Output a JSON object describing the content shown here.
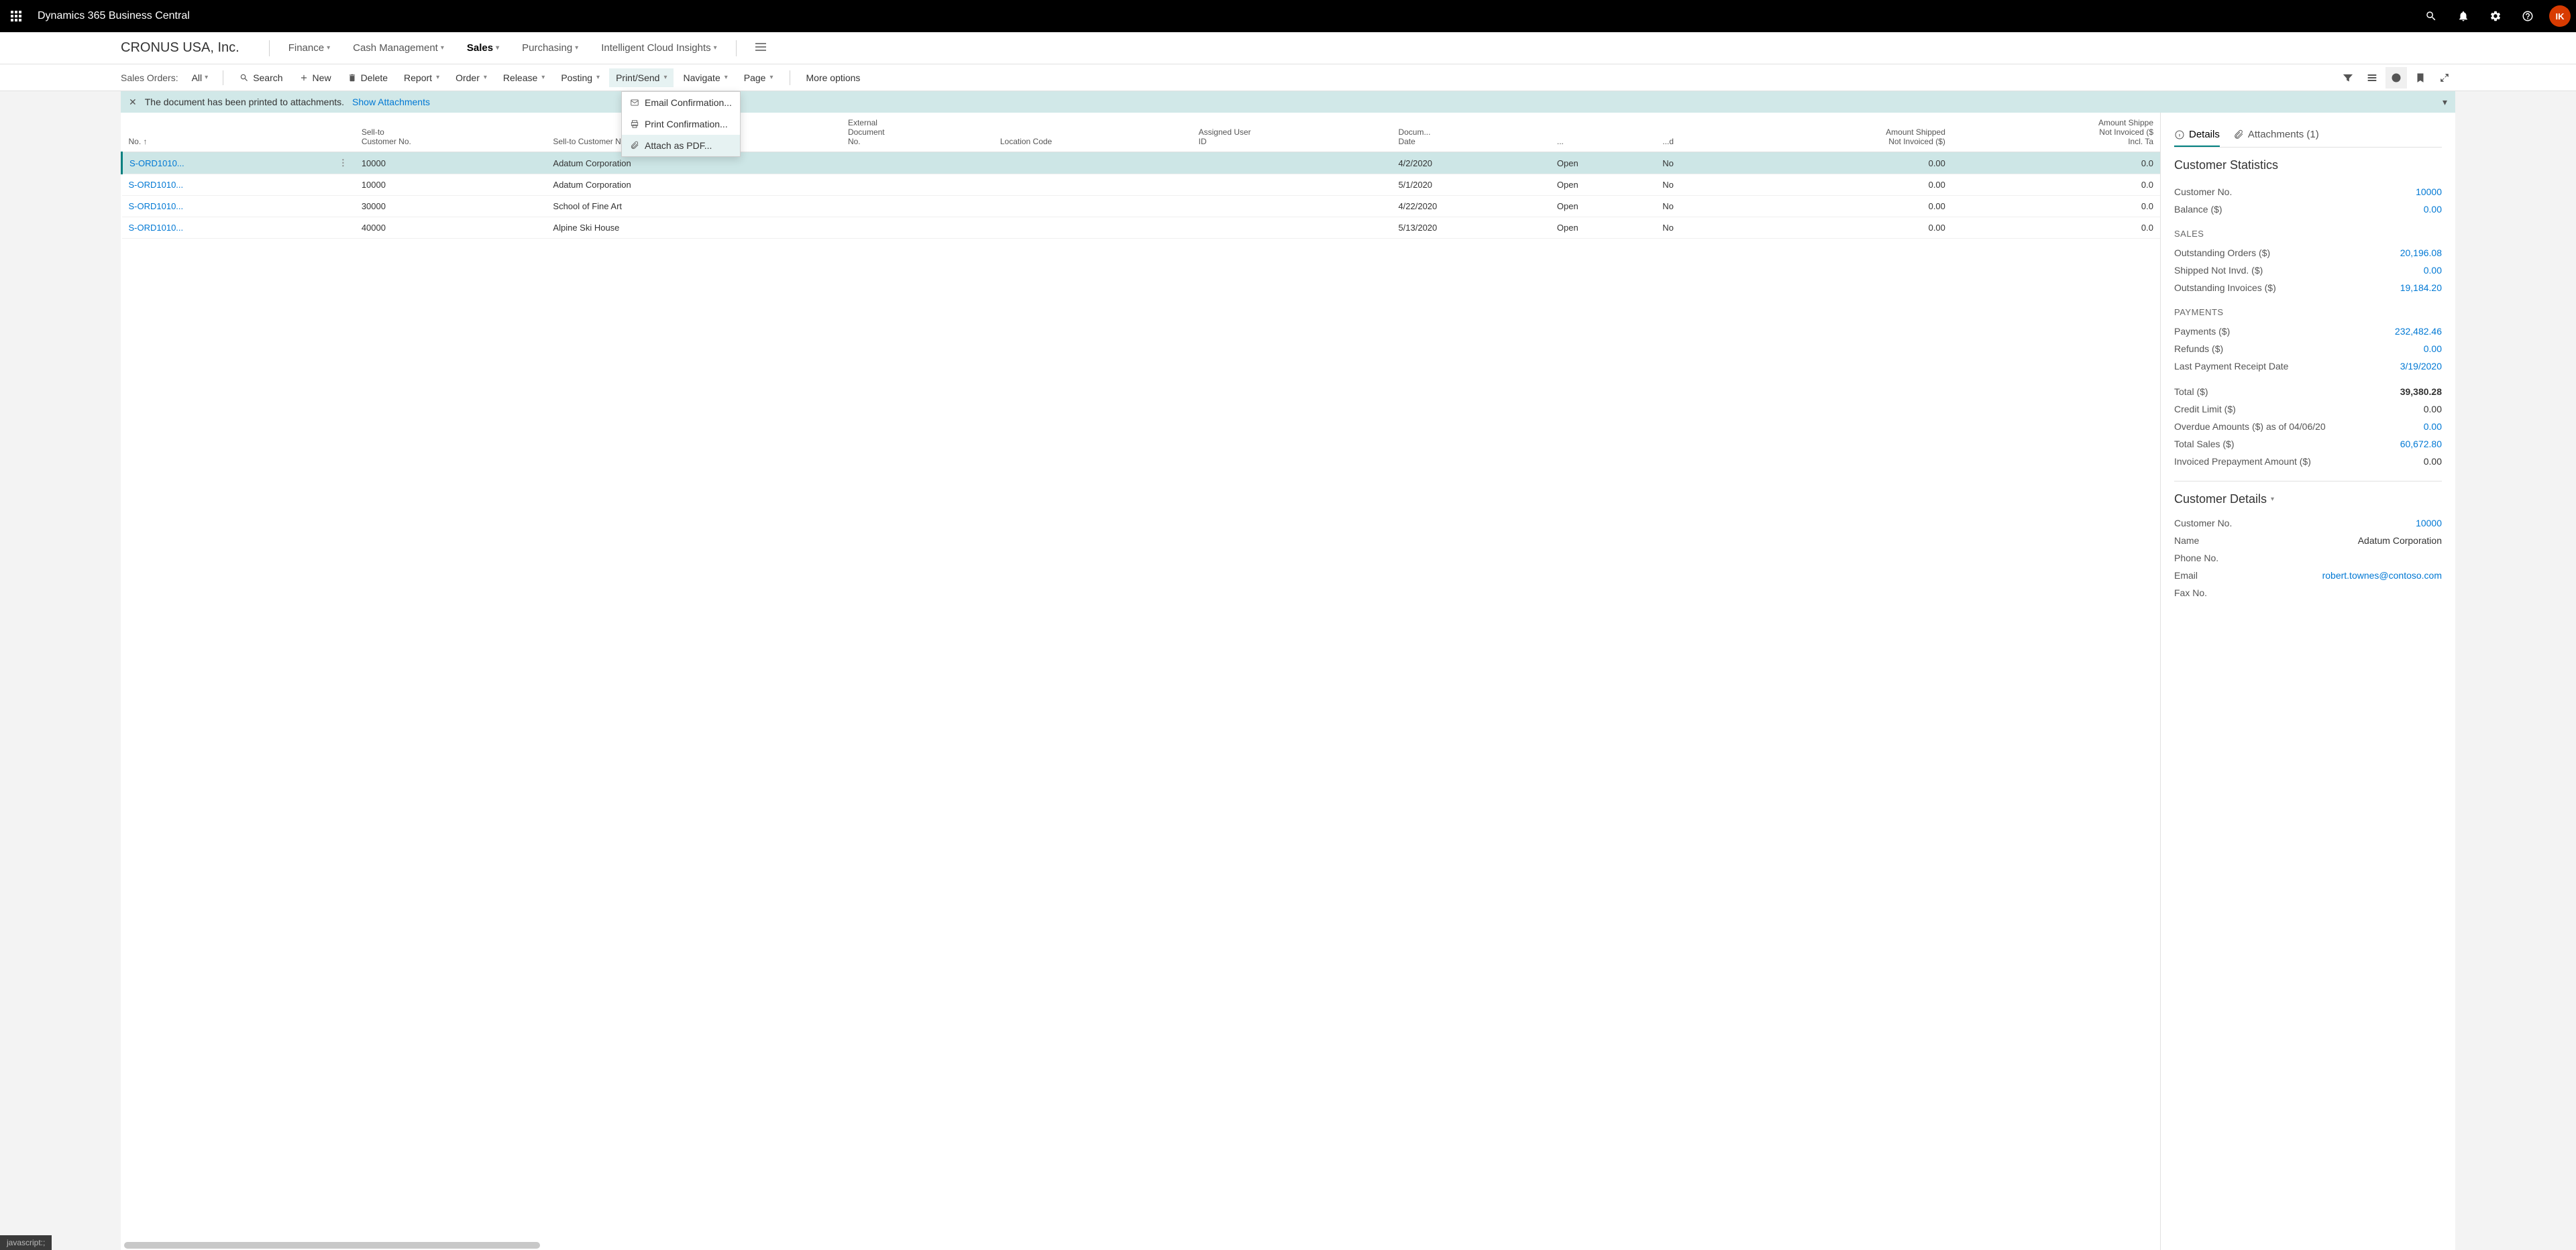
{
  "topbar": {
    "app_title": "Dynamics 365 Business Central",
    "avatar_initials": "IK"
  },
  "navbar": {
    "company": "CRONUS USA, Inc.",
    "items": [
      "Finance",
      "Cash Management",
      "Sales",
      "Purchasing",
      "Intelligent Cloud Insights"
    ],
    "active_index": 2
  },
  "toolbar": {
    "label": "Sales Orders:",
    "filter": "All",
    "search": "Search",
    "new": "New",
    "delete": "Delete",
    "report": "Report",
    "order": "Order",
    "release": "Release",
    "posting": "Posting",
    "print_send": "Print/Send",
    "navigate": "Navigate",
    "page": "Page",
    "more": "More options"
  },
  "dropdown": {
    "items": [
      {
        "label": "Email Confirmation...",
        "icon": "mail"
      },
      {
        "label": "Print Confirmation...",
        "icon": "print"
      },
      {
        "label": "Attach as PDF...",
        "icon": "attach"
      }
    ],
    "hover_index": 2
  },
  "notification": {
    "text": "The document has been printed to attachments.",
    "link": "Show Attachments"
  },
  "table": {
    "headers": {
      "no": "No. ↑",
      "sell_to_no": "Sell-to\nCustomer No.",
      "sell_to_name": "Sell-to Customer Name",
      "ext_doc": "External\nDocument\nNo.",
      "location": "Location Code",
      "assigned": "Assigned User\nID",
      "doc_date": "Docum...\nDate",
      "status": "...",
      "d": "...d",
      "amt_shipped": "Amount Shipped\nNot Invoiced ($)",
      "amt_shipped_incl": "Amount Shippe\nNot Invoiced ($\nIncl. Ta"
    },
    "rows": [
      {
        "no": "S-ORD1010...",
        "cust_no": "10000",
        "cust_name": "Adatum Corporation",
        "ext": "",
        "loc": "",
        "user": "",
        "date": "4/2/2020",
        "status": "Open",
        "d": "No",
        "amt1": "0.00",
        "amt2": "0.0",
        "selected": true
      },
      {
        "no": "S-ORD1010...",
        "cust_no": "10000",
        "cust_name": "Adatum Corporation",
        "ext": "",
        "loc": "",
        "user": "",
        "date": "5/1/2020",
        "status": "Open",
        "d": "No",
        "amt1": "0.00",
        "amt2": "0.0"
      },
      {
        "no": "S-ORD1010...",
        "cust_no": "30000",
        "cust_name": "School of Fine Art",
        "ext": "",
        "loc": "",
        "user": "",
        "date": "4/22/2020",
        "status": "Open",
        "d": "No",
        "amt1": "0.00",
        "amt2": "0.0"
      },
      {
        "no": "S-ORD1010...",
        "cust_no": "40000",
        "cust_name": "Alpine Ski House",
        "ext": "",
        "loc": "",
        "user": "",
        "date": "5/13/2020",
        "status": "Open",
        "d": "No",
        "amt1": "0.00",
        "amt2": "0.0"
      }
    ]
  },
  "factbox": {
    "tabs": {
      "details": "Details",
      "attachments": "Attachments (1)"
    },
    "stats_title": "Customer Statistics",
    "stats": [
      {
        "label": "Customer No.",
        "value": "10000",
        "link": true
      },
      {
        "label": "Balance ($)",
        "value": "0.00",
        "link": true
      }
    ],
    "sales_title": "SALES",
    "sales": [
      {
        "label": "Outstanding Orders ($)",
        "value": "20,196.08",
        "link": true
      },
      {
        "label": "Shipped Not Invd. ($)",
        "value": "0.00",
        "link": true
      },
      {
        "label": "Outstanding Invoices ($)",
        "value": "19,184.20",
        "link": true
      }
    ],
    "payments_title": "PAYMENTS",
    "payments": [
      {
        "label": "Payments ($)",
        "value": "232,482.46",
        "link": true
      },
      {
        "label": "Refunds ($)",
        "value": "0.00",
        "link": true
      },
      {
        "label": "Last Payment Receipt Date",
        "value": "3/19/2020",
        "link": true
      }
    ],
    "totals": [
      {
        "label": "Total ($)",
        "value": "39,380.28",
        "bold": true
      },
      {
        "label": "Credit Limit ($)",
        "value": "0.00"
      },
      {
        "label": "Overdue Amounts ($) as of 04/06/20",
        "value": "0.00",
        "link": true
      },
      {
        "label": "Total Sales ($)",
        "value": "60,672.80",
        "link": true
      },
      {
        "label": "Invoiced Prepayment Amount ($)",
        "value": "0.00"
      }
    ],
    "details_title": "Customer Details",
    "details": [
      {
        "label": "Customer No.",
        "value": "10000",
        "link": true
      },
      {
        "label": "Name",
        "value": "Adatum Corporation"
      },
      {
        "label": "Phone No.",
        "value": ""
      },
      {
        "label": "Email",
        "value": "robert.townes@contoso.com",
        "link": true
      },
      {
        "label": "Fax No.",
        "value": ""
      }
    ]
  },
  "statusbar": "javascript:;"
}
